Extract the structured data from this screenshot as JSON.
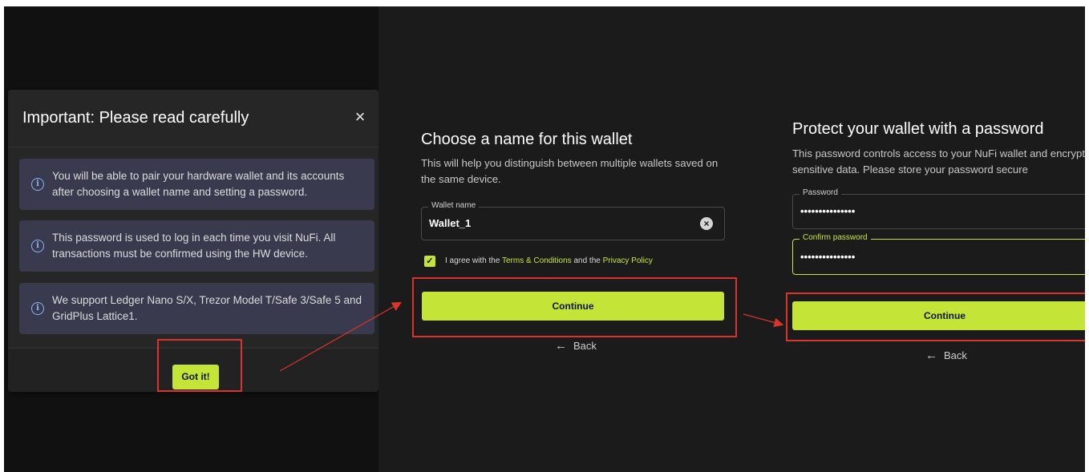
{
  "dialog": {
    "title": "Important: Please read carefully",
    "close_icon": "×",
    "info_icon": "i",
    "items": [
      "You will be able to pair your hardware wallet and its accounts after choosing a wallet name and setting a password.",
      "This password is used to log in each time you visit NuFi. All transactions must be confirmed using the HW device.",
      "We support Ledger Nano S/X, Trezor Model T/Safe 3/Safe 5 and GridPlus Lattice1."
    ],
    "button": "Got it!"
  },
  "wallet_name": {
    "title": "Choose a name for this wallet",
    "subtitle": "This will help you distinguish between multiple wallets saved on the same device.",
    "field_label": "Wallet name",
    "field_value": "Wallet_1",
    "clear_icon": "×",
    "check_mark": "✓",
    "agree_prefix": "I agree with the ",
    "terms_link": "Terms & Conditions",
    "agree_mid": " and the ",
    "privacy_link": "Privacy Policy",
    "continue": "Continue",
    "back_arrow": "←",
    "back": "Back"
  },
  "password": {
    "title": "Protect your wallet with a password",
    "subtitle": "This password controls access to your NuFi wallet and encrypts sensitive data. Please store your password secure",
    "password_label": "Password",
    "password_value": "•••••••••••••••",
    "confirm_label": "Confirm password",
    "confirm_value": "•••••••••••••••",
    "continue": "Continue",
    "back_arrow": "←",
    "back": "Back"
  },
  "colors": {
    "accent": "#c4e538",
    "annotation_red": "#d9342b",
    "info_bg": "#393a4d"
  }
}
